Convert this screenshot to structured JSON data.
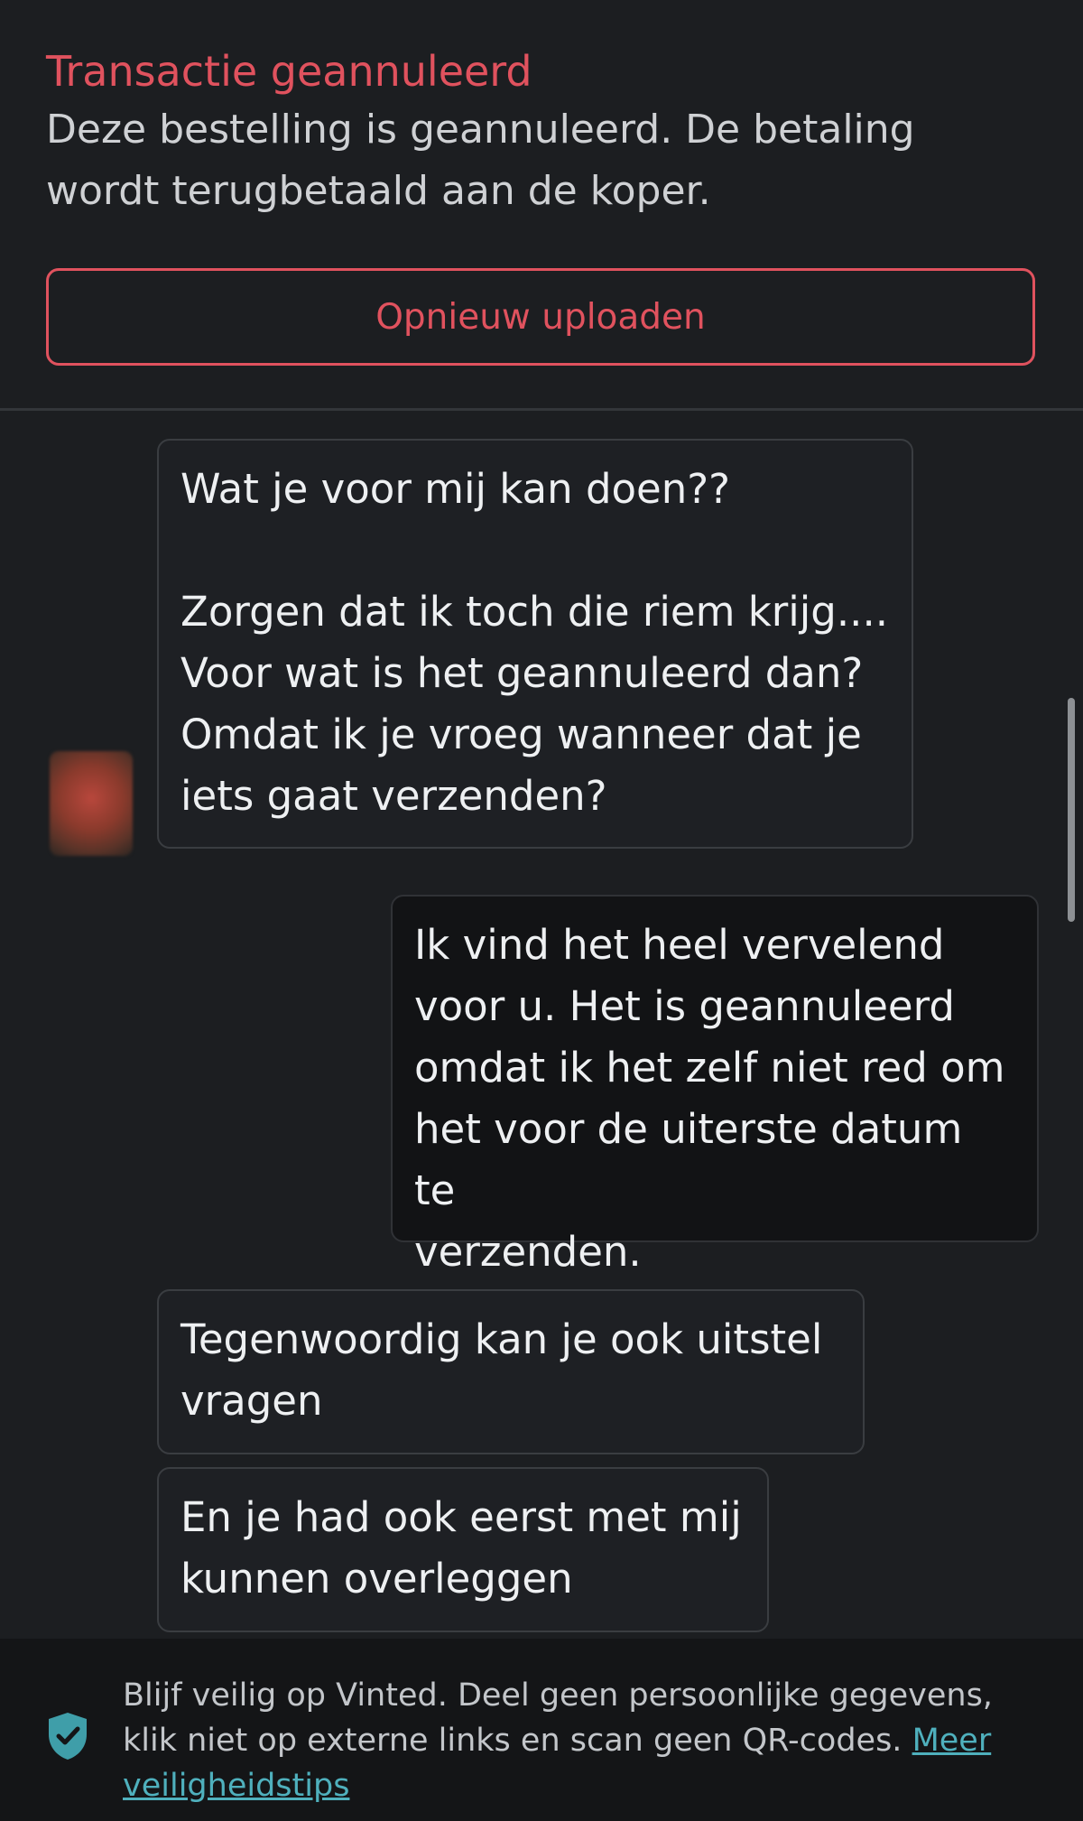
{
  "status": {
    "title": "Transactie geannuleerd",
    "description": "Deze bestelling is geannuleerd. De betaling wordt terugbetaald aan de koper.",
    "action_label": "Opnieuw uploaden",
    "accent_color": "#e0525e"
  },
  "chat": {
    "messages": [
      {
        "sender": "other",
        "text": "Wat je voor mij kan doen??\n\nZorgen dat ik toch die riem krijg....\nVoor wat is het geannuleerd dan?\nOmdat ik je vroeg wanneer dat je\niets gaat verzenden?"
      },
      {
        "sender": "me",
        "text": "Ik vind het heel vervelend\nvoor u. Het is geannuleerd\nomdat ik het zelf niet red om\nhet voor de uiterste datum te\nverzenden."
      },
      {
        "sender": "other",
        "text": "Tegenwoordig kan je ook uitstel\nvragen"
      },
      {
        "sender": "other",
        "text": "En je had ook eerst met mij\nkunnen overleggen"
      }
    ]
  },
  "footer": {
    "icon": "shield-check-icon",
    "safety_text": "Blijf veilig op Vinted. Deel geen persoonlijke gegevens, klik niet op externe links en scan geen QR-codes. ",
    "link_label": "Meer veiligheidstips",
    "link_color": "#4fb0bd"
  }
}
